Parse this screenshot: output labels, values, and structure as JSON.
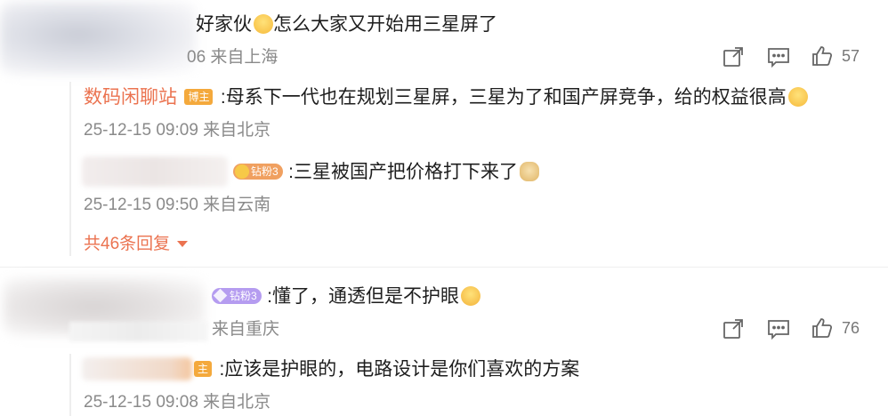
{
  "comments": [
    {
      "text": "好家伙",
      "text_after": "怎么大家又开始用三星屏了",
      "meta_visible": "06 来自上海",
      "likes": "57",
      "replies": [
        {
          "author": "数码闲聊站",
          "badge": "博主",
          "text": ":母系下一代也在规划三星屏，三星为了和国产屏竞争，给的权益很高",
          "meta": "25-12-15 09:09 来自北京"
        },
        {
          "badge": "钻粉3",
          "text": ":三星被国产把价格打下来了",
          "meta": "25-12-15 09:50 来自云南"
        }
      ],
      "more_replies": "共46条回复"
    },
    {
      "badge": "钻粉3",
      "text": ":懂了，通透但是不护眼",
      "meta_visible": "来自重庆",
      "likes": "76",
      "replies": [
        {
          "badge": "主",
          "text": ":应该是护眼的，电路设计是你们喜欢的方案",
          "meta": "25-12-15 09:08 来自北京"
        }
      ]
    }
  ],
  "icons": {
    "share": "share-icon",
    "comment": "comment-icon",
    "like": "thumbs-up-icon"
  },
  "colors": {
    "accent": "#eb7350",
    "host_badge": "#f4a93c",
    "fan_badge_1": "#f0a060",
    "fan_badge_2": "#b59cf0"
  }
}
